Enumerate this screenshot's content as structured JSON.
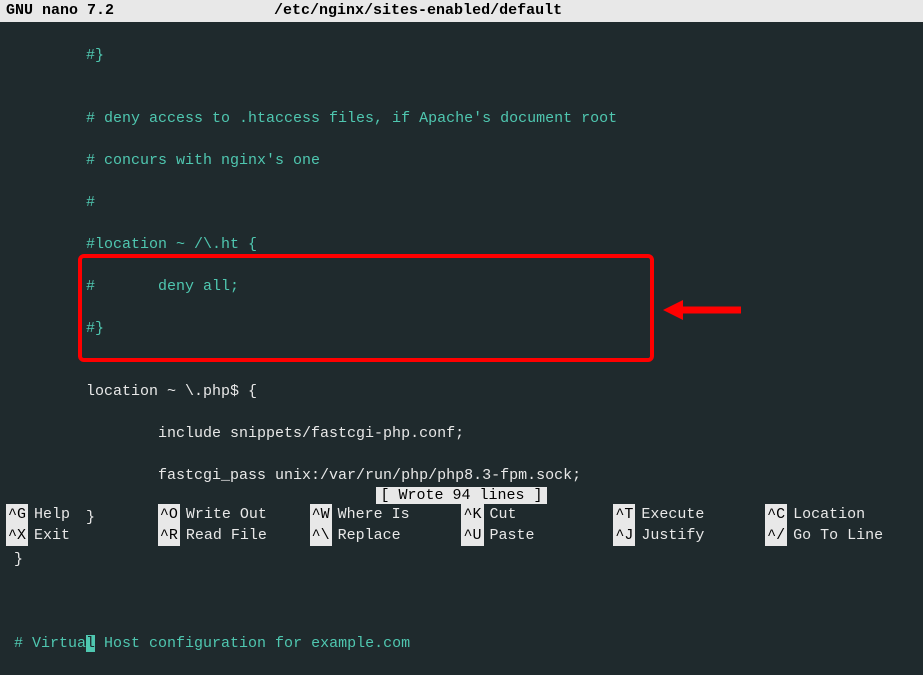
{
  "titlebar": {
    "app": "GNU nano 7.2",
    "path": "/etc/nginx/sites-enabled/default"
  },
  "lines": {
    "l1": "        #}",
    "l2": "",
    "l3": "        # deny access to .htaccess files, if Apache's document root",
    "l4": "        # concurs with nginx's one",
    "l5": "        #",
    "l6": "        #location ~ /\\.ht {",
    "l7": "        #       deny all;",
    "l8": "        #}",
    "l9": "",
    "l10": "        location ~ \\.php$ {",
    "l11": "                include snippets/fastcgi-php.conf;",
    "l12": "                fastcgi_pass unix:/var/run/php/php8.3-fpm.sock;",
    "l13": "        }",
    "l14": "}",
    "l15": "",
    "l16": "",
    "cursor_before": "# Virtua",
    "cursor_char": "l",
    "cursor_after": " Host configuration for example.com"
  },
  "status": "[ Wrote 94 lines ]",
  "shortcuts": {
    "row1": [
      {
        "key": "^G",
        "label": "Help"
      },
      {
        "key": "^O",
        "label": "Write Out"
      },
      {
        "key": "^W",
        "label": "Where Is"
      },
      {
        "key": "^K",
        "label": "Cut"
      },
      {
        "key": "^T",
        "label": "Execute"
      },
      {
        "key": "^C",
        "label": "Location"
      }
    ],
    "row2": [
      {
        "key": "^X",
        "label": "Exit"
      },
      {
        "key": "^R",
        "label": "Read File"
      },
      {
        "key": "^\\",
        "label": "Replace"
      },
      {
        "key": "^U",
        "label": "Paste"
      },
      {
        "key": "^J",
        "label": "Justify"
      },
      {
        "key": "^/",
        "label": "Go To Line"
      }
    ]
  }
}
